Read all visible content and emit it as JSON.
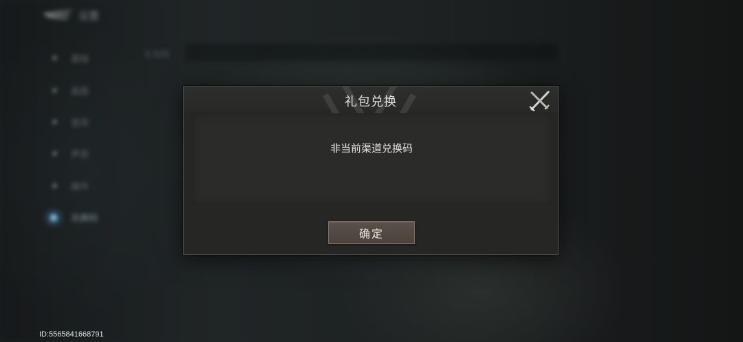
{
  "background": {
    "title": "设置",
    "subtitle": "礼包码",
    "menu_items": [
      "基础",
      "画面",
      "音效",
      "声音",
      "操作",
      "兑换码"
    ],
    "active_index": 5
  },
  "dialog": {
    "title": "礼包兑换",
    "message": "非当前渠道兑换码",
    "confirm_label": "确定",
    "close_icon": "crossed-swords-close-icon"
  },
  "footer": {
    "player_id": "ID:5565841668791"
  },
  "colors": {
    "dialog_bg": "#262625",
    "dialog_border": "#4b4a46",
    "button_bg": "#4a423c",
    "text": "#e8e6e1",
    "active_glow": "#8cc8f0"
  }
}
